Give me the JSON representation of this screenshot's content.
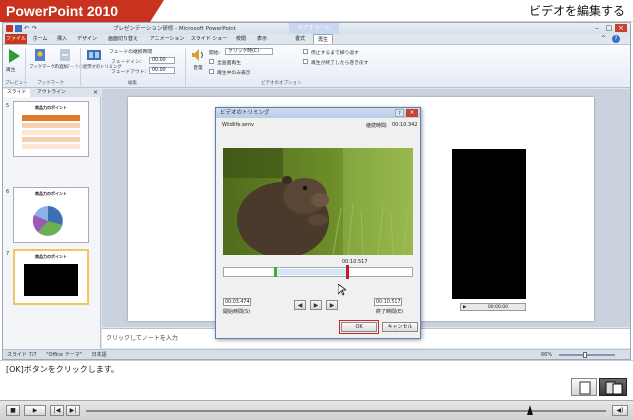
{
  "banner": {
    "product": "PowerPoint 2010",
    "lesson_title": "ビデオを編集する"
  },
  "window": {
    "title": "プレゼンテーション研修 - Microsoft PowerPoint",
    "context_group": "ビデオ ツール",
    "tabs": [
      "ファイル",
      "ホーム",
      "挿入",
      "デザイン",
      "画面切り替え",
      "アニメーション",
      "スライド ショー",
      "校閲",
      "表示",
      "書式",
      "再生"
    ],
    "active_tab": "再生"
  },
  "ribbon": {
    "preview": {
      "play_label": "再生",
      "group": "プレビュー"
    },
    "bookmarks": {
      "add_label": "ブックマークの追加",
      "remove_label": "ブックマークの削除",
      "group": "ブックマーク"
    },
    "editing": {
      "trim_label": "ビデオのトリミング",
      "fade_duration": "フェードの継続時間",
      "fade_in_label": "フェードイン:",
      "fade_in_value": "00.00",
      "fade_out_label": "フェードアウト:",
      "fade_out_value": "00.00",
      "group": "編集"
    },
    "options": {
      "volume_label": "音量",
      "start_label": "開始:",
      "start_value": "クリック時(C)",
      "fullscreen": "全画面再生",
      "hide_when_not_playing": "再生中のみ表示",
      "loop": "停止するまで繰り返す",
      "rewind": "再生が終了したら巻き戻す",
      "group": "ビデオのオプション"
    }
  },
  "left_pane": {
    "tabs": [
      "スライド",
      "アウトライン"
    ],
    "slides": [
      {
        "num": "5",
        "title": "商品力のポイント"
      },
      {
        "num": "6",
        "title": "商品力のポイント"
      },
      {
        "num": "7",
        "title": "商品力のポイント"
      }
    ]
  },
  "notes_placeholder": "クリックしてノートを入力",
  "status": {
    "slide": "スライド 7/7",
    "theme": "\"Office テーマ\"",
    "language": "日本語",
    "zoom": "66%"
  },
  "dialog": {
    "title": "ビデオのトリミング",
    "filename": "Wildlife.wmv",
    "duration_label": "継続時間:",
    "duration_value": "00:10.342",
    "marker_time": "00:10.517",
    "start_time": "00:03.474",
    "start_label": "開始時間(S)",
    "end_time": "00:10.517",
    "end_label": "終了時間(E)",
    "ok": "OK",
    "cancel": "キャンセル"
  },
  "slide_video": {
    "time": "00:00.00"
  },
  "instruction": "[OK]ボタンをクリックします。",
  "colors": {
    "banner_red": "#c8321e",
    "ok_highlight": "#d8202a",
    "start_marker": "#3fae2a",
    "end_marker": "#c0201c"
  }
}
